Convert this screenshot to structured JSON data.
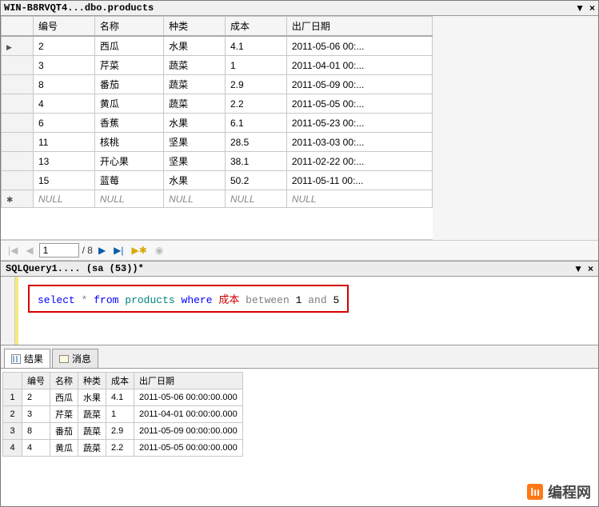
{
  "top_tab": {
    "title": "WIN-B8RVQT4...dbo.products",
    "pin": "▼",
    "close": "×"
  },
  "columns": [
    "编号",
    "名称",
    "种类",
    "成本",
    "出厂日期"
  ],
  "rows": [
    {
      "id": "2",
      "name": "西瓜",
      "kind": "水果",
      "cost": "4.1",
      "date": "2011-05-06 00:..."
    },
    {
      "id": "3",
      "name": "芹菜",
      "kind": "蔬菜",
      "cost": "1",
      "date": "2011-04-01 00:..."
    },
    {
      "id": "8",
      "name": "番茄",
      "kind": "蔬菜",
      "cost": "2.9",
      "date": "2011-05-09 00:..."
    },
    {
      "id": "4",
      "name": "黄瓜",
      "kind": "蔬菜",
      "cost": "2.2",
      "date": "2011-05-05 00:..."
    },
    {
      "id": "6",
      "name": "香蕉",
      "kind": "水果",
      "cost": "6.1",
      "date": "2011-05-23 00:..."
    },
    {
      "id": "11",
      "name": "核桃",
      "kind": "坚果",
      "cost": "28.5",
      "date": "2011-03-03 00:..."
    },
    {
      "id": "13",
      "name": "开心果",
      "kind": "坚果",
      "cost": "38.1",
      "date": "2011-02-22 00:..."
    },
    {
      "id": "15",
      "name": "蓝莓",
      "kind": "水果",
      "cost": "50.2",
      "date": "2011-05-11 00:..."
    }
  ],
  "null_row": "NULL",
  "paginator": {
    "page": "1",
    "total": "/ 8"
  },
  "query_tab": {
    "title": "SQLQuery1.... (sa (53))*",
    "pin": "▼",
    "close": "×"
  },
  "sql": {
    "select": "select",
    "star": "*",
    "from": "from",
    "tbl": "products",
    "where": "where",
    "col": "成本",
    "between": "between",
    "a": "1",
    "and": "and",
    "b": "5"
  },
  "result_tabs": {
    "results": "结果",
    "messages": "消息"
  },
  "result_cols": [
    "编号",
    "名称",
    "种类",
    "成本",
    "出厂日期"
  ],
  "result_rows": [
    {
      "n": "1",
      "id": "2",
      "name": "西瓜",
      "kind": "水果",
      "cost": "4.1",
      "date": "2011-05-06 00:00:00.000"
    },
    {
      "n": "2",
      "id": "3",
      "name": "芹菜",
      "kind": "蔬菜",
      "cost": "1",
      "date": "2011-04-01 00:00:00.000"
    },
    {
      "n": "3",
      "id": "8",
      "name": "番茄",
      "kind": "蔬菜",
      "cost": "2.9",
      "date": "2011-05-09 00:00:00.000"
    },
    {
      "n": "4",
      "id": "4",
      "name": "黄瓜",
      "kind": "蔬菜",
      "cost": "2.2",
      "date": "2011-05-05 00:00:00.000"
    }
  ],
  "watermark": {
    "logo": "lıı",
    "text": "编程网"
  }
}
